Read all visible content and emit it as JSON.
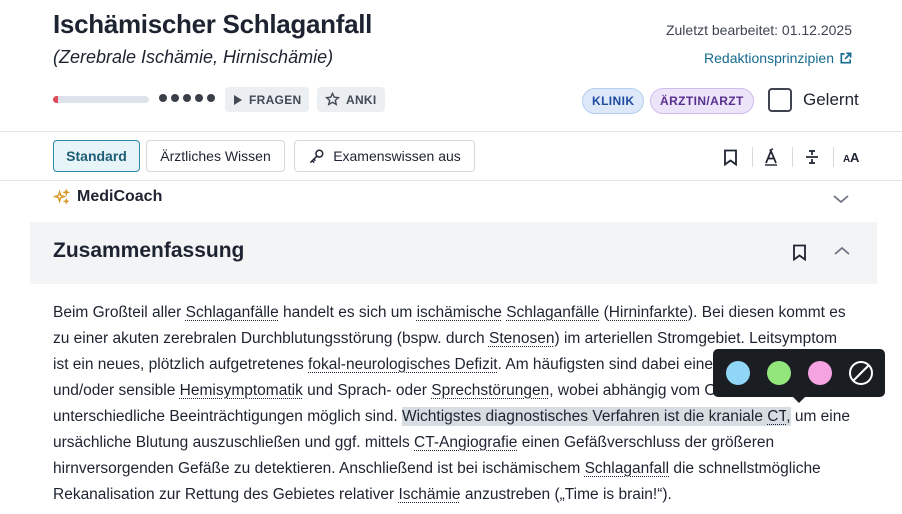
{
  "article": {
    "title": "Ischämischer Schlaganfall",
    "subtitle": "(Zerebrale Ischämie, Hirnischämie)",
    "last_edited": "Zuletzt bearbeitet: 01.12.2025",
    "principles_link": "Redaktionsprinzipien",
    "progress_fraction": 0.05,
    "fragen_label": "FRAGEN",
    "anki_label": "ANKI",
    "badges": [
      "KLINIK",
      "ÄRZTIN/ARZT"
    ],
    "learned_label": "Gelernt"
  },
  "toolbar": {
    "tabs": [
      "Standard",
      "Ärztliches Wissen",
      "Examenswissen aus"
    ]
  },
  "medicoach": {
    "label": "MediCoach"
  },
  "summary": {
    "title": "Zusammenfassung",
    "paragraph": [
      {
        "t": "Beim Großteil aller "
      },
      {
        "t": "Schlaganfälle",
        "u": true
      },
      {
        "t": " handelt es sich um "
      },
      {
        "t": "ischämische",
        "u": true
      },
      {
        "t": " "
      },
      {
        "t": "Schlaganfälle",
        "u": true
      },
      {
        "t": " ("
      },
      {
        "t": "Hirninfarkte",
        "u": true
      },
      {
        "t": "). Bei diesen kommt es zu einer akuten zerebralen Durchblutungsstörung (bspw. durch "
      },
      {
        "t": "Stenosen",
        "u": true
      },
      {
        "t": ") im arteriellen Stromgebiet. Leitsymptom ist ein neues, plötzlich aufgetretenes "
      },
      {
        "t": "fokal-neurologisches Defizit",
        "u": true
      },
      {
        "t": ". Am häufigsten sind dabei eine motorische und/oder sensible "
      },
      {
        "t": "Hemisymptomatik",
        "u": true
      },
      {
        "t": " und Sprach- oder "
      },
      {
        "t": "Sprechstörungen",
        "u": true
      },
      {
        "t": ", wobei abhängig vom Ort der Läsion unterschiedliche Beeinträchtigungen möglich sind. "
      },
      {
        "t": "Wichtigstes diagnostisches Verfahren ist die kraniale ",
        "h": true
      },
      {
        "t": "CT",
        "u": true,
        "h": true
      },
      {
        "t": ",",
        "h": true
      },
      {
        "t": " um eine ursächliche Blutung auszuschließen und ggf. mittels "
      },
      {
        "t": "CT-Angiografie",
        "u": true
      },
      {
        "t": " einen Gefäßverschluss der größeren hirnversorgenden Gefäße zu detektieren. Anschließend ist bei ischämischem "
      },
      {
        "t": "Schlaganfall",
        "u": true
      },
      {
        "t": " die schnellstmögliche Rekanalisation zur Rettung des Gebietes relativer "
      },
      {
        "t": "Ischämie",
        "u": true
      },
      {
        "t": " anzustreben („Time is brain!“)."
      }
    ]
  },
  "highlight_picker": {
    "colors": [
      "#8fd6f7",
      "#93e67c",
      "#f6a3e2"
    ]
  },
  "colors": {
    "accent": "#2f8aa8",
    "link": "#166b8f",
    "progress": "#e04a5a",
    "highlight": "#d8dde2"
  }
}
